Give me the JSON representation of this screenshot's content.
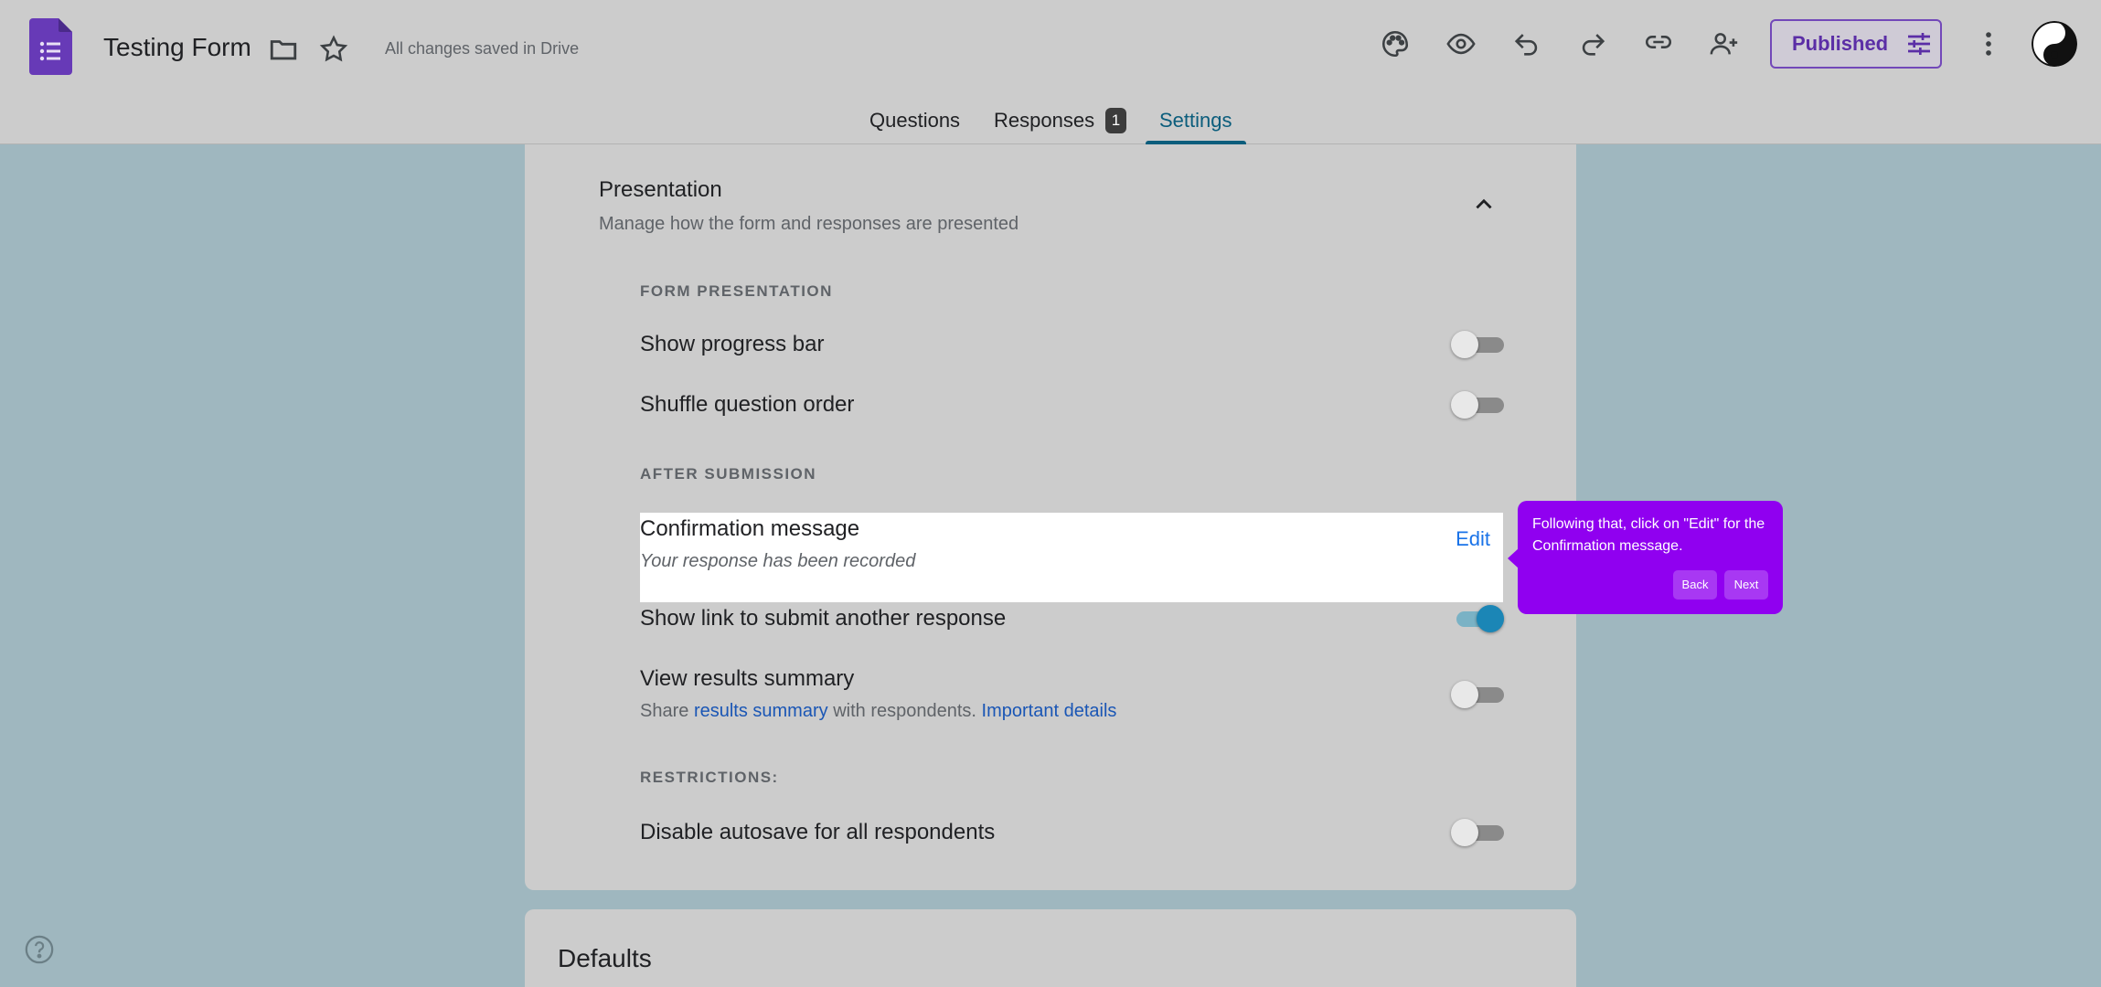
{
  "header": {
    "title": "Testing Form",
    "saved_status": "All changes saved in Drive",
    "published_label": "Published"
  },
  "tabs": [
    {
      "label": "Questions"
    },
    {
      "label": "Responses",
      "badge": "1"
    },
    {
      "label": "Settings",
      "active": true
    }
  ],
  "presentation": {
    "title": "Presentation",
    "subtitle": "Manage how the form and responses are presented",
    "form_presentation_heading": "FORM PRESENTATION",
    "show_progress_bar": {
      "label": "Show progress bar",
      "enabled": false
    },
    "shuffle_question_order": {
      "label": "Shuffle question order",
      "enabled": false
    },
    "after_submission_heading": "AFTER SUBMISSION",
    "confirmation_message": {
      "label": "Confirmation message",
      "value": "Your response has been recorded",
      "edit_label": "Edit"
    },
    "show_link_another_response": {
      "label": "Show link to submit another response",
      "enabled": true
    },
    "view_results_summary": {
      "label": "View results summary",
      "sub_prefix": "Share",
      "sub_link1": "results summary",
      "sub_middle": "with respondents.",
      "sub_link2": "Important details",
      "enabled": false
    },
    "restrictions_heading": "RESTRICTIONS:",
    "disable_autosave": {
      "label": "Disable autosave for all respondents",
      "enabled": false
    }
  },
  "defaults": {
    "title": "Defaults"
  },
  "tooltip": {
    "text": "Following that, click on \"Edit\" for the Confirmation message.",
    "back_label": "Back",
    "next_label": "Next"
  },
  "colors": {
    "accent": "#0b5d7c",
    "forms_purple": "#673ab7",
    "tooltip_bg": "#9000f0",
    "toggle_on": "#1b86b6"
  },
  "icons": [
    "forms-logo-icon",
    "folder-icon",
    "star-icon",
    "palette-icon",
    "eye-icon",
    "undo-icon",
    "redo-icon",
    "link-icon",
    "add-person-icon",
    "sliders-icon",
    "more-vert-icon",
    "chevron-up-icon",
    "help-icon"
  ]
}
